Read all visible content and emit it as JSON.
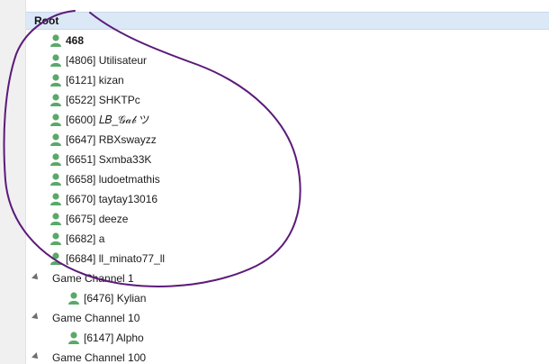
{
  "tree": {
    "root_label": "Root",
    "root_children": [
      {
        "label": "468",
        "bold": true
      },
      {
        "label": "[4806] Utilisateur"
      },
      {
        "label": "[6121] kizan"
      },
      {
        "label": "[6522] SHKTPc"
      },
      {
        "label": "[6600] 𝐿𝐵_𝒢𝒶𝒷 ツ"
      },
      {
        "label": "[6647] RBXswayzz"
      },
      {
        "label": "[6651] Sxmba33K"
      },
      {
        "label": "[6658] ludoetmathis"
      },
      {
        "label": "[6670] taytay13016"
      },
      {
        "label": "[6675] deeze"
      },
      {
        "label": "[6682] a"
      },
      {
        "label": "[6684] ll_minato77_ll"
      }
    ],
    "channels": [
      {
        "label": "Game Channel 1",
        "users": [
          {
            "label": "[6476] Kylian"
          }
        ]
      },
      {
        "label": "Game Channel 10",
        "users": [
          {
            "label": "[6147] Alpho"
          }
        ]
      },
      {
        "label": "Game Channel 100",
        "users": []
      }
    ]
  },
  "colors": {
    "user_icon": "#5aa86a",
    "selection": "#dbe8f6",
    "annotation_stroke": "#5b1a7a"
  },
  "icons": {
    "user": "user-icon",
    "expander": "expander-triangle-icon"
  }
}
